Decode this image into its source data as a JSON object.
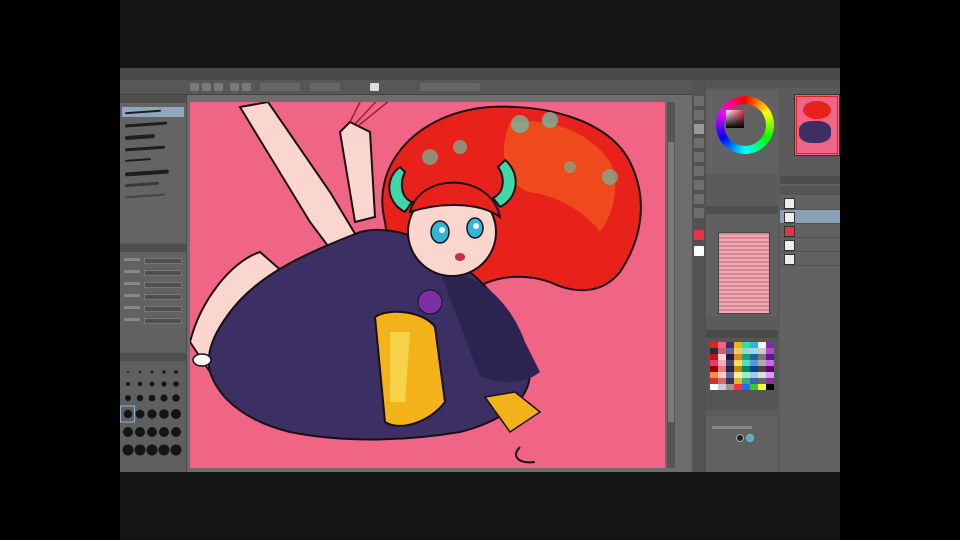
{
  "window": {
    "title": ""
  },
  "menu": {
    "items": [
      "",
      "",
      "",
      "",
      "",
      "",
      "",
      "",
      "",
      ""
    ]
  },
  "panels": {
    "brush": {
      "title": ""
    },
    "tool_property": {
      "title": ""
    },
    "brush_size": {
      "title": ""
    },
    "color_wheel": {
      "title": "",
      "current_color": "#e8324a"
    },
    "navigator": {
      "title": ""
    },
    "sub_view": {
      "title": ""
    },
    "color_set": {
      "title": ""
    },
    "layers": {
      "title": "",
      "items": [
        {
          "name": "",
          "selected": false
        },
        {
          "name": "",
          "selected": true
        },
        {
          "name": "",
          "selected": false
        },
        {
          "name": "",
          "selected": false
        },
        {
          "name": "",
          "selected": false
        }
      ]
    }
  },
  "canvas": {
    "background_color": "#f06585",
    "hair_color": "#e8211b",
    "outfit_color": "#3b2f63",
    "belt_color": "#f4b21a",
    "horn_color": "#3fd6a8"
  },
  "icons": [
    "pen-icon",
    "eraser-icon",
    "selection-icon",
    "fill-icon",
    "eyedropper-icon",
    "move-icon",
    "text-icon",
    "zoom-icon",
    "hand-icon"
  ]
}
